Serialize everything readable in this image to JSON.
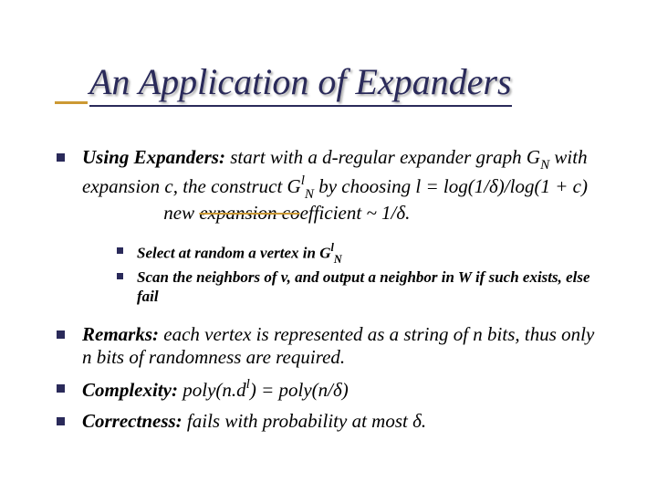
{
  "title": "An Application of Expanders",
  "p1a": "Using Expanders:",
  "p1b": " start with a d-regular expander graph G",
  "p1b_sub": "N",
  "p1c": " with expansion c, the construct G",
  "p1c_sup": "l",
  "p1c_sub": "N",
  "p1d": " by choosing l = log(1/δ)/log(1 + c)",
  "p1e_gap": "                 ",
  "p1e": "new ",
  "p1e_strike": "expansion co",
  "p1f": "efficient ~ 1/δ.",
  "s1a": "Select at random a vertex in G",
  "s1a_sup": "l",
  "s1a_sub": "N",
  "s2": "Scan the neighbors of v, and output a neighbor in W if such exists, else fail",
  "p2a": "Remarks:",
  "p2b": " each vertex is represented as a string of n bits, thus only n bits of randomness are required.",
  "p3a": "Complexity:",
  "p3b": " poly(n.d",
  "p3b_sup": "l",
  "p3c": ") = poly(n/δ)",
  "p4a": "Correctness:",
  "p4b": " fails with probability at most δ."
}
